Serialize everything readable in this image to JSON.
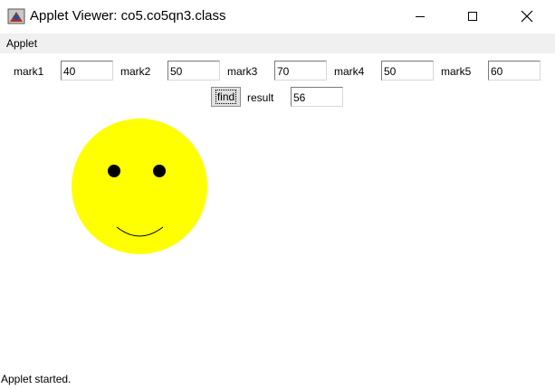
{
  "window": {
    "title": "Applet Viewer: co5.co5qn3.class"
  },
  "menu": {
    "items": [
      "Applet"
    ]
  },
  "form": {
    "marks": [
      {
        "label": "mark1",
        "value": "40"
      },
      {
        "label": "mark2",
        "value": "50"
      },
      {
        "label": "mark3",
        "value": "70"
      },
      {
        "label": "mark4",
        "value": "50"
      },
      {
        "label": "mark5",
        "value": "60"
      }
    ],
    "find_label": "find",
    "result_label": "result",
    "result_value": "56"
  },
  "drawing": {
    "face_color": "#ffff00",
    "feature_color": "#000000",
    "expression": "smile"
  },
  "status_text": "Applet started."
}
